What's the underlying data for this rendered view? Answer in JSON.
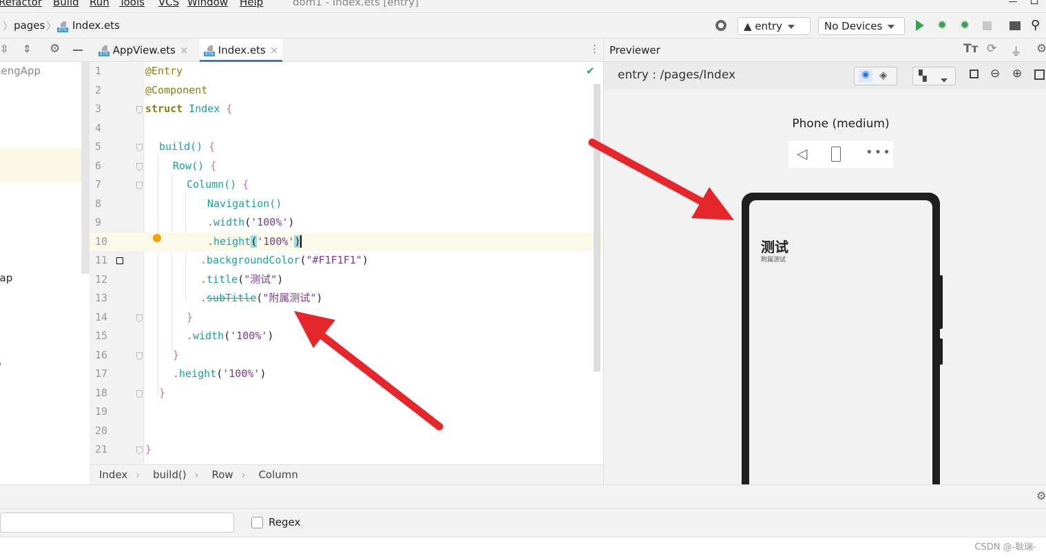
{
  "menu": [
    "Refactor",
    "Build",
    "Run",
    "Tools",
    "VCS",
    "Window",
    "Help"
  ],
  "window_title": "dom1 - Index.ets [entry]",
  "nav": {
    "crumbs": [
      "pages",
      "Index.ets"
    ],
    "module": "entry",
    "device": "No Devices"
  },
  "tabs": [
    {
      "label": "AppView.ets",
      "active": false
    },
    {
      "label": "Index.ets",
      "active": true
    }
  ],
  "project": {
    "items": [
      "nengApp",
      "nap",
      "p"
    ]
  },
  "code": [
    {
      "n": "1",
      "t": "@Entry"
    },
    {
      "n": "2",
      "t": "@Component"
    },
    {
      "n": "3",
      "t": "struct Index {"
    },
    {
      "n": "4",
      "t": ""
    },
    {
      "n": "5",
      "t": "build() {"
    },
    {
      "n": "6",
      "t": "Row() {"
    },
    {
      "n": "7",
      "t": "Column() {"
    },
    {
      "n": "8",
      "t": "Navigation()"
    },
    {
      "n": "9",
      "t": ".width('100%')"
    },
    {
      "n": "10",
      "t": ".height('100%')"
    },
    {
      "n": "11",
      "t": ".backgroundColor(\"#F1F1F1\")"
    },
    {
      "n": "12",
      "t": ".title(\"测试\")"
    },
    {
      "n": "13",
      "t": ".subTitle(\"附属测试\")"
    },
    {
      "n": "14",
      "t": "}"
    },
    {
      "n": "15",
      "t": ".width('100%')"
    },
    {
      "n": "16",
      "t": "}"
    },
    {
      "n": "17",
      "t": ".height('100%')"
    },
    {
      "n": "18",
      "t": "}"
    },
    {
      "n": "19",
      "t": ""
    },
    {
      "n": "20",
      "t": ""
    },
    {
      "n": "21",
      "t": "}"
    }
  ],
  "breadcrumb": [
    "Index",
    "build()",
    "Row",
    "Column"
  ],
  "previewer": {
    "title": "Previewer",
    "path": "entry : /pages/Index",
    "device_name": "Phone (medium)",
    "screen_title": "测试",
    "screen_subtitle": "附属测试"
  },
  "bottom": {
    "regex_label": "Regex",
    "regex_checked": false,
    "search_value": ""
  },
  "watermark": "CSDN @-耿瑞-",
  "colors": {
    "accent": "#3b78c8",
    "run": "#3aa153",
    "annotation": "#e5262b"
  }
}
